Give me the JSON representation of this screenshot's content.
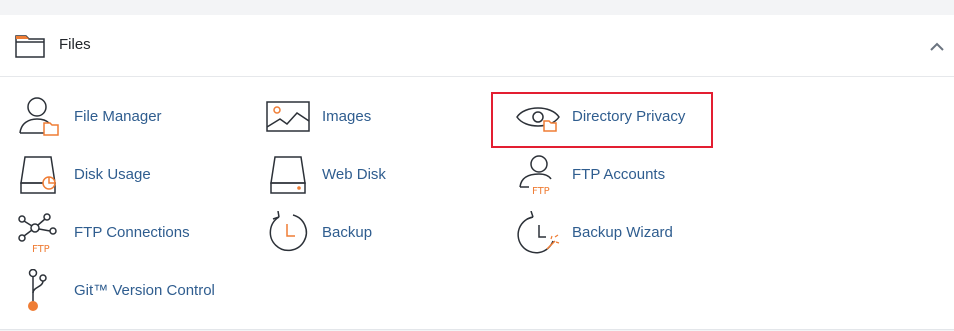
{
  "panel": {
    "title": "Files",
    "icons": {
      "header": "folder-icon",
      "collapse": "chevron-up-icon"
    }
  },
  "items": [
    {
      "label": "File Manager",
      "icon": "file-manager-icon"
    },
    {
      "label": "Images",
      "icon": "images-icon"
    },
    {
      "label": "Directory Privacy",
      "icon": "directory-privacy-icon",
      "highlighted": true
    },
    {
      "label": "Disk Usage",
      "icon": "disk-usage-icon"
    },
    {
      "label": "Web Disk",
      "icon": "web-disk-icon"
    },
    {
      "label": "FTP Accounts",
      "icon": "ftp-accounts-icon",
      "icon_text": "FTP"
    },
    {
      "label": "FTP Connections",
      "icon": "ftp-connections-icon",
      "icon_text": "FTP"
    },
    {
      "label": "Backup",
      "icon": "backup-icon"
    },
    {
      "label": "Backup Wizard",
      "icon": "backup-wizard-icon"
    },
    {
      "label": "Git™ Version Control",
      "icon": "git-version-control-icon"
    }
  ],
  "colors": {
    "label": "#2f5d8f",
    "icon_stroke": "#2c3138",
    "icon_accent": "#ef7d35",
    "highlight_border": "#e31e31"
  }
}
